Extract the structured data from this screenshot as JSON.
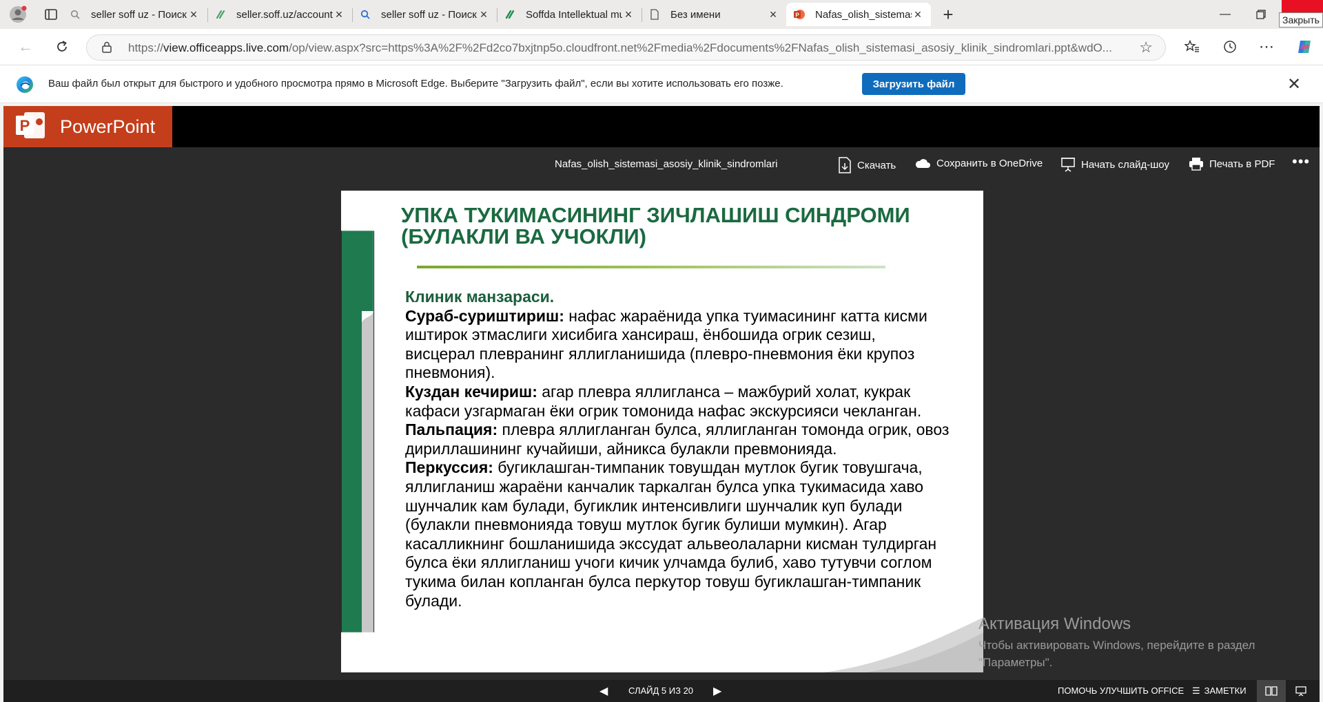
{
  "browser": {
    "tabs": [
      {
        "label": "seller soff uz - Поиск",
        "favicon": "search-icon",
        "active": false
      },
      {
        "label": "seller.soff.uz/account/login",
        "favicon": "soff-icon",
        "active": false
      },
      {
        "label": "seller soff uz - Поиск",
        "favicon": "search-icon",
        "active": false
      },
      {
        "label": "Soffda Intellektual mulklari",
        "favicon": "soff-icon",
        "active": false
      },
      {
        "label": "Без имени",
        "favicon": "page-icon",
        "active": false
      },
      {
        "label": "Nafas_olish_sistemasi_asosi",
        "favicon": "powerpoint-icon",
        "active": true
      }
    ],
    "close_tooltip": "Закрыть",
    "url": {
      "scheme": "https://",
      "host": "view.officeapps.live.com",
      "rest": "/op/view.aspx?src=https%3A%2F%2Fd2co7bxjtnp5o.cloudfront.net%2Fmedia%2Fdocuments%2FNafas_olish_sistemasi_asosiy_klinik_sindromlari.ppt&wdO..."
    }
  },
  "infobar": {
    "message": "Ваш файл был открыт для быстрого и удобного просмотра прямо в Microsoft Edge. Выберите \"Загрузить файл\", если вы хотите использовать его позже.",
    "download_label": "Загрузить файл"
  },
  "viewer": {
    "app_name": "PowerPoint",
    "doc_title": "Nafas_olish_sistemasi_asosiy_klinik_sindromlari",
    "commands": {
      "download": "Скачать",
      "save_onedrive": "Сохранить в OneDrive",
      "slideshow": "Начать слайд-шоу",
      "print_pdf": "Печать в PDF"
    }
  },
  "slide": {
    "title": "УПКА ТУКИМАСИНИНГ ЗИЧЛАШИШ СИНДРОМИ (БУЛАКЛИ ВА УЧОКЛИ)",
    "subtitle": "Клиник манзараси.",
    "paragraphs": [
      {
        "label": "Сураб-суриштириш:",
        "text": " нафас жараёнида упка туимасининг катта кисми иштирок этмаслиги хисибига хансираш, ёнбошида огрик сезиш, висцерал плевранинг яллигланишида (плевро-пневмония ёки крупоз пневмония)."
      },
      {
        "label": "Куздан кечириш:",
        "text": " агар плевра яллигланса – мажбурий холат, кукрак кафаси узгармаган ёки огрик томонида нафас  экскурсияси чекланган."
      },
      {
        "label": "Пальпация:",
        "text": " плевра яллигланган булса, яллигланган томонда огрик, овоз дириллашининг кучайиши, айникса булакли превмонияда."
      },
      {
        "label": "Перкуссия:",
        "text": " бугиклашган-тимпаник товушдан мутлок бугик товушгача, яллигланиш жараёни канчалик  таркалган булса упка тукимасида хаво шунчалик кам булади, бугиклик интенсивлиги шунчалик куп булади (булакли пневмонияда товуш мутлок бугик булиши мумкин). Агар касалликнинг бошланишида экссудат альвеолаларни кисман тулдирган булса ёки яллигланиш учоги кичик улчамда булиб, хаво тутувчи соглом тукима билан копланган булса перкутор товуш бугиклашган-тимпаник булади."
      }
    ]
  },
  "watermark": {
    "line1": "Активация Windows",
    "line2": "Чтобы активировать Windows, перейдите в раздел",
    "line3": "\"Параметры\"."
  },
  "statusbar": {
    "slide_counter": "СЛАЙД 5 ИЗ 20",
    "help_improve": "ПОМОЧЬ УЛУЧШИТЬ OFFICE",
    "notes": "ЗАМЕТКИ"
  },
  "colors": {
    "ppt_brand": "#c43e1c",
    "edge_blue": "#0f6cbd",
    "slide_title_green": "#1a6a40",
    "slide_bar_green": "#1f7a50"
  }
}
